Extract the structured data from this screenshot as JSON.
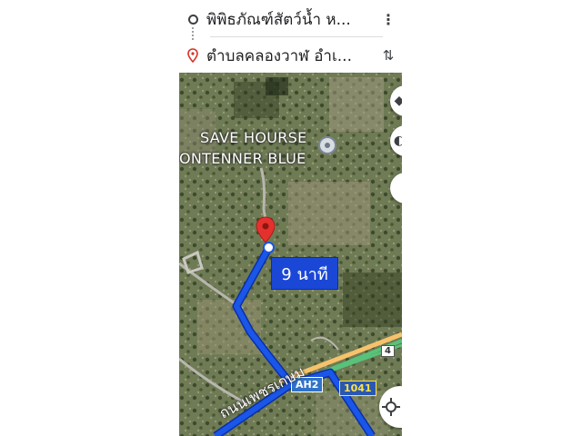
{
  "directions": {
    "origin_text": "พิพิธภัณฑ์สัตว์น้ำ ห...",
    "destination_text": "ตำบลคลองวาฬ อำเ...",
    "origin_icon": "circle-icon",
    "destination_icon": "pin-icon",
    "more_icon": "more-vert-icon",
    "swap_icon": "swap-icon"
  },
  "map": {
    "place_label_line1": "SAVE HOURSE",
    "place_label_line2": "ONTENNER BLUE",
    "eta_label": "9 นาที",
    "route_shield_ah2": "AH2",
    "route_shield_1041": "1041",
    "route_shield_4": "4",
    "road_name": "ถนนเพชรเกษม",
    "route_color": "#1a56e8",
    "pin_color": "#e5312d"
  },
  "controls": {
    "layers_icon": "layers-icon",
    "compass_icon": "compass-icon",
    "blank_control_icon": "control-icon",
    "recenter_icon": "location-crosshair-icon"
  }
}
